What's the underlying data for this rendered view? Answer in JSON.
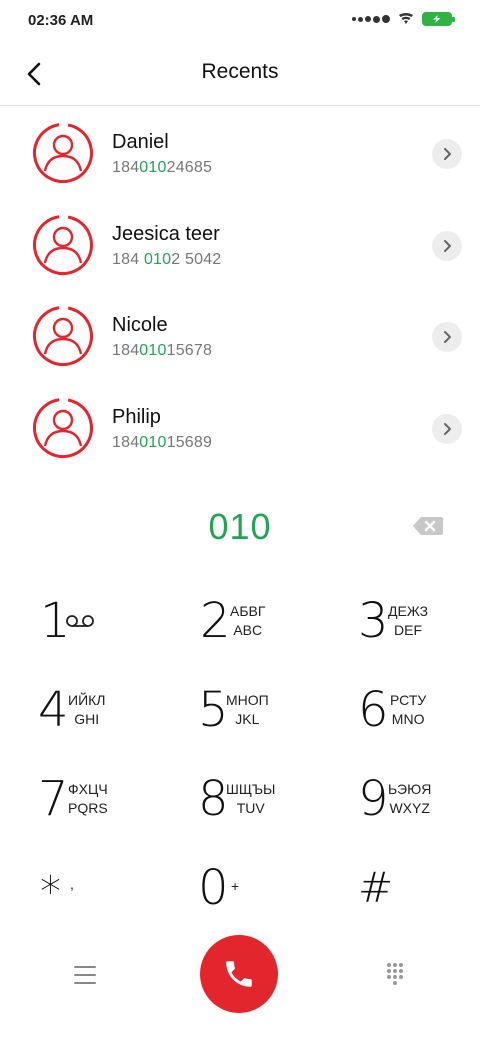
{
  "status_bar": {
    "time": "02:36 AM",
    "icons": [
      "signal-dots-icon",
      "wifi-icon",
      "battery-charging-icon"
    ]
  },
  "header": {
    "title": "Recents",
    "back_icon": "chevron-left-icon"
  },
  "recents": [
    {
      "name": "Daniel",
      "number_pre": "184",
      "number_match": "010",
      "number_post": "24685"
    },
    {
      "name": "Jeesica teer",
      "number_pre": "184 ",
      "number_match": "010",
      "number_post": "2 5042"
    },
    {
      "name": "Nicole",
      "number_pre": "184",
      "number_match": "010",
      "number_post": "15678"
    },
    {
      "name": "Philip",
      "number_pre": "184",
      "number_match": "010",
      "number_post": "15689"
    }
  ],
  "dialer": {
    "dialed": "010"
  },
  "keypad": {
    "keys": [
      {
        "digit": "1",
        "line1": "",
        "line2": "",
        "icon": "voicemail-icon"
      },
      {
        "digit": "2",
        "line1": "АБВГ",
        "line2": "ABC"
      },
      {
        "digit": "3",
        "line1": "ДЕЖЗ",
        "line2": "DEF"
      },
      {
        "digit": "4",
        "line1": "ИЙКЛ",
        "line2": "GHI"
      },
      {
        "digit": "5",
        "line1": "МНОП",
        "line2": "JKL"
      },
      {
        "digit": "6",
        "line1": "РСТУ",
        "line2": "MNO"
      },
      {
        "digit": "7",
        "line1": "ФХЦЧ",
        "line2": "PQRS"
      },
      {
        "digit": "8",
        "line1": "ШЩЪЫ",
        "line2": "TUV"
      },
      {
        "digit": "9",
        "line1": "ЬЭЮЯ",
        "line2": "WXYZ"
      },
      {
        "digit": "*",
        "line1": ",",
        "line2": ""
      },
      {
        "digit": "0",
        "line1": "+",
        "line2": ""
      },
      {
        "digit": "#",
        "line1": "",
        "line2": ""
      }
    ]
  },
  "colors": {
    "accent_green": "#22a455",
    "call_red": "#e3262d",
    "avatar_red": "#e3262d"
  }
}
